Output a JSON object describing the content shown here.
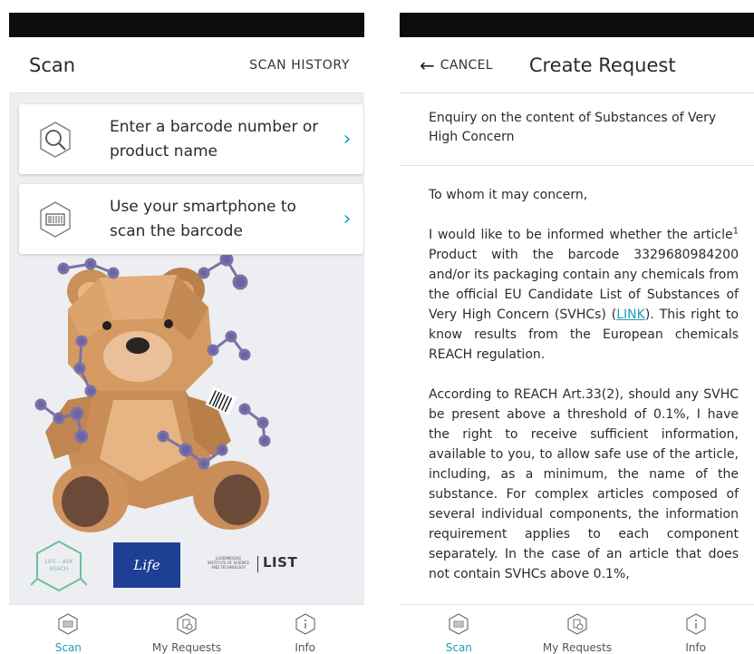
{
  "colors": {
    "accent": "#1a9fb6",
    "status_bar": "#0d0d0d",
    "background": "#eceef1"
  },
  "scan_screen": {
    "title": "Scan",
    "action": "SCAN HISTORY",
    "cards": [
      {
        "icon": "magnifier-icon",
        "label": "Enter a barcode number or product name",
        "chevron": "›"
      },
      {
        "icon": "barcode-hexagon-icon",
        "label": "Use your smartphone to scan the barcode",
        "chevron": "›"
      }
    ],
    "logos": {
      "life_ask_reach": "LIFE – ASK\nREACH",
      "eu_life": "Life",
      "institute": "LUXEMBOURG\nINSTITUTE OF SCIENCE\nAND TECHNOLOGY",
      "list": "LIST"
    }
  },
  "request_screen": {
    "back_arrow": "←",
    "cancel": "CANCEL",
    "title": "Create Request",
    "subject": "Enquiry on the content of Substances of Very High Concern",
    "greeting": "To whom it may concern,",
    "para1_a": "I would like to be informed whether the article",
    "para1_sup": "1",
    "para1_b": " Product with the barcode 3329680984200 and/or its packaging contain any chemicals from the official EU Candidate List of Substances of Very High Concern (SVHCs) (",
    "para1_link": "LINK",
    "para1_c": "). This right to know results from the European chemicals REACH regulation.",
    "para2": "According to REACH Art.33(2), should any SVHC be present above a threshold of 0.1%, I have the right to receive sufficient information, available to you, to allow safe use of the article, including, as a minimum, the name of the substance. For complex articles composed of several individual components, the information requirement applies to each component separately. In the case of an article that does not contain SVHCs above 0.1%,"
  },
  "bottom_nav": [
    {
      "label": "Scan",
      "icon": "scan-barcode-icon",
      "active": true
    },
    {
      "label": "My Requests",
      "icon": "document-clock-icon",
      "active": false
    },
    {
      "label": "Info",
      "icon": "info-icon",
      "active": false
    }
  ]
}
